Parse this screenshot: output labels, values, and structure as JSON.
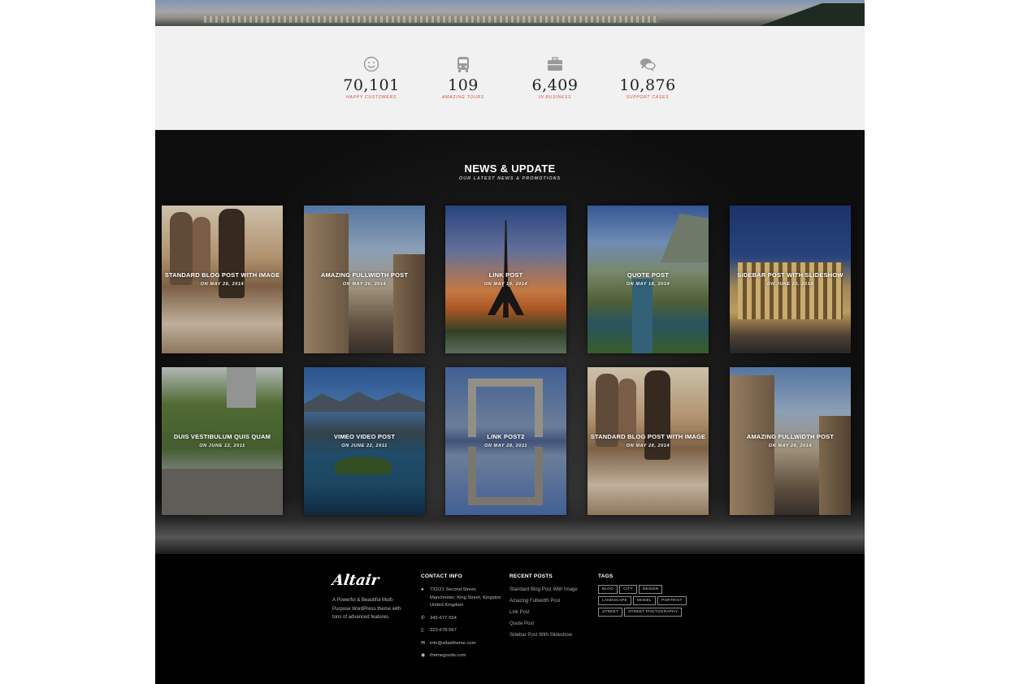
{
  "stats": [
    {
      "icon": "smile-icon",
      "value": "70,101",
      "label": "HAPPY CUSTOMERS"
    },
    {
      "icon": "bus-icon",
      "value": "109",
      "label": "AMAZING TOURS"
    },
    {
      "icon": "briefcase-icon",
      "value": "6,409",
      "label": "IN BUSINESS"
    },
    {
      "icon": "chat-icon",
      "value": "10,876",
      "label": "SUPPORT CASES"
    }
  ],
  "news": {
    "title": "NEWS & UPDATE",
    "subtitle": "OUR LATEST NEWS & PROMOTIONS",
    "posts": [
      {
        "title": "STANDARD BLOG POST WITH IMAGE",
        "date": "ON MAY 28, 2014"
      },
      {
        "title": "AMAZING FULLWIDTH POST",
        "date": "ON MAY 26, 2014"
      },
      {
        "title": "LINK POST",
        "date": "ON MAY 19, 2014"
      },
      {
        "title": "QUOTE POST",
        "date": "ON MAY 18, 2014"
      },
      {
        "title": "SIDEBAR POST WITH SLIDESHOW",
        "date": "ON JUNE 20, 2014"
      },
      {
        "title": "DUIS VESTIBULUM QUIS QUAM",
        "date": "ON JUNE 12, 2011"
      },
      {
        "title": "VIMEO VIDEO POST",
        "date": "ON JUNE 22, 2011"
      },
      {
        "title": "LINK POST2",
        "date": "ON MAY 28, 2011"
      },
      {
        "title": "STANDARD BLOG POST WITH IMAGE",
        "date": "ON MAY 28, 2014"
      },
      {
        "title": "AMAZING FULLWIDTH POST",
        "date": "ON MAY 26, 2014"
      }
    ]
  },
  "footer": {
    "logo": "Altair",
    "about": "A Powerful & Beautiful Multi-Purpose WordPress theme with tons of advanced features.",
    "contact": {
      "heading": "CONTACT INFO",
      "address": "732/21 Second Street, Manchester, King Street, Kingston United Kingdom",
      "phone": "345-677-554",
      "mobile": "323-678-567",
      "email": "info@altairtheme.com",
      "website": "themegoods.com"
    },
    "recent": {
      "heading": "RECENT POSTS",
      "items": [
        "Standard Blog Post With Image",
        "Amazing Fullwidth Post",
        "Link Post",
        "Quote Post",
        "Sidebar Post With Slideshow"
      ]
    },
    "tags": {
      "heading": "TAGS",
      "items": [
        "BLOG",
        "CITY",
        "DESIGN",
        "LANDSCAPE",
        "MODEL",
        "PORTRAIT",
        "STREET",
        "STREET PHOTOGRAPHY"
      ]
    }
  }
}
